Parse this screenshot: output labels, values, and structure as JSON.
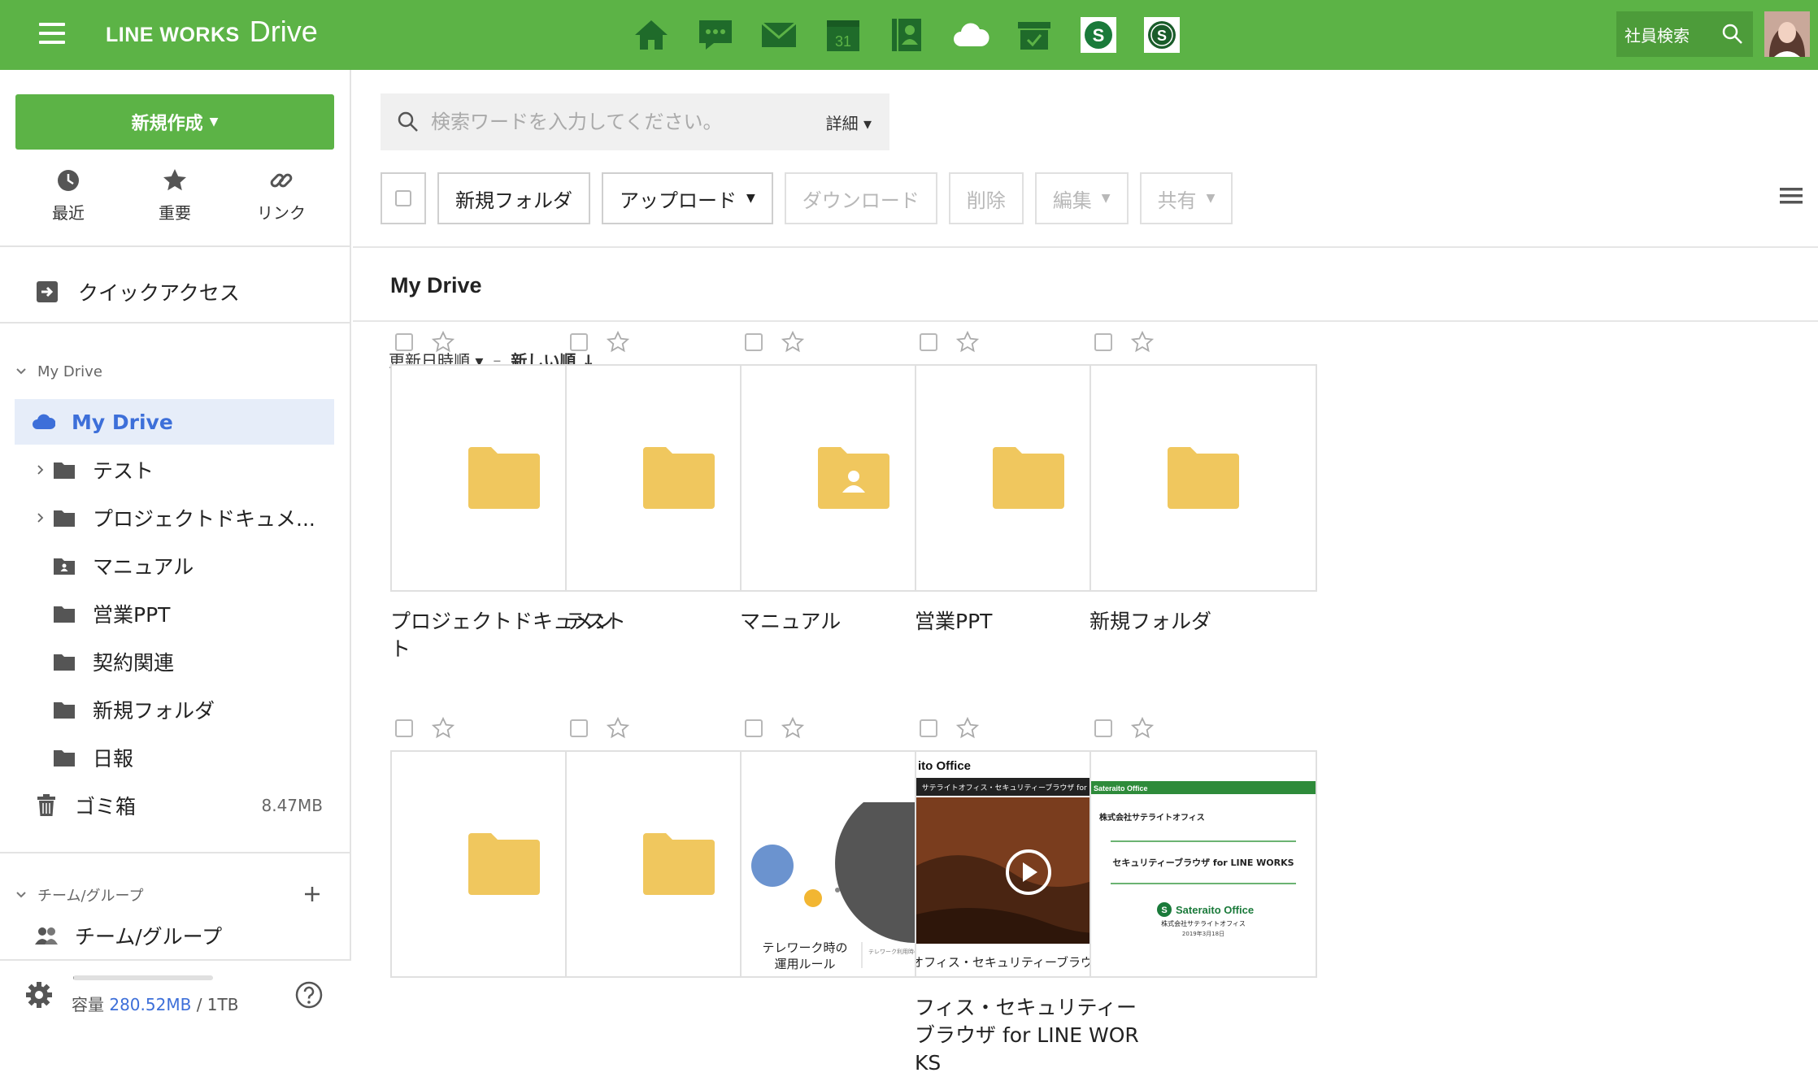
{
  "header": {
    "brand_main": "LINE WORKS",
    "brand_sub": "Drive",
    "calendar_day": "31",
    "employee_search_label": "社員検索",
    "colors": {
      "bar": "#5cb346",
      "icon": "#1f6b2a"
    }
  },
  "sidebar": {
    "new_button": "新規作成",
    "quick": [
      {
        "label": "最近",
        "icon": "clock-icon"
      },
      {
        "label": "重要",
        "icon": "star-icon"
      },
      {
        "label": "リンク",
        "icon": "link-icon"
      }
    ],
    "quick_access": "クイックアクセス",
    "my_drive_section": "My Drive",
    "tree": [
      {
        "label": "My Drive",
        "icon": "cloud-icon",
        "active": true
      },
      {
        "label": "テスト",
        "icon": "folder-icon",
        "expandable": true
      },
      {
        "label": "プロジェクトドキュメ...",
        "icon": "folder-icon",
        "expandable": true
      },
      {
        "label": "マニュアル",
        "icon": "shared-folder-icon"
      },
      {
        "label": "営業PPT",
        "icon": "folder-icon"
      },
      {
        "label": "契約関連",
        "icon": "folder-icon"
      },
      {
        "label": "新規フォルダ",
        "icon": "folder-icon"
      },
      {
        "label": "日報",
        "icon": "folder-icon"
      }
    ],
    "trash": {
      "label": "ゴミ箱",
      "size": "8.47MB"
    },
    "team_section": "チーム/グループ",
    "team_item": "チーム/グループ",
    "storage": {
      "label": "容量",
      "used": "280.52MB",
      "total": "/ 1TB",
      "used_fraction": 0.0003
    }
  },
  "main": {
    "search_placeholder": "検索ワードを入力してください。",
    "search_detail": "詳細",
    "toolbar": {
      "new_folder": "新規フォルダ",
      "upload": "アップロード",
      "download": "ダウンロード",
      "delete": "削除",
      "edit": "編集",
      "share": "共有"
    },
    "title": "My Drive",
    "sort": {
      "field": "更新日時順",
      "order": "新しい順 ↓"
    },
    "items": [
      {
        "name": "プロジェクトドキュメント",
        "type": "folder"
      },
      {
        "name": "テスト",
        "type": "folder"
      },
      {
        "name": "マニュアル",
        "type": "shared-folder"
      },
      {
        "name": "営業PPT",
        "type": "folder"
      },
      {
        "name": "新規フォルダ",
        "type": "folder"
      },
      {
        "name": "",
        "type": "folder"
      },
      {
        "name": "",
        "type": "folder"
      },
      {
        "name": "",
        "type": "doc-telework",
        "thumb_text": [
          "テレワーク時の",
          "運用ルール"
        ],
        "thumb_note": "テレワーク利用時のマニュアルです。"
      },
      {
        "name": "フィス・セキュリティーブラウザ for LINE WORKS",
        "type": "doc-slide",
        "thumb_head": "ito Office",
        "thumb_sub": "サテライトオフィス・セキュリティーブラウザ for LINE WORKS",
        "thumb_headline": "サテライトオフィス・セキュリティーブラウザ for LINE WORKS"
      },
      {
        "name": "",
        "type": "doc-pdf",
        "thumb_brand": "Sateraito Office",
        "thumb_company": "株式会社サテライトオフィス",
        "thumb_title": "セキュリティーブラウザ for LINE WORKS",
        "thumb_logo": "Sateraito Office",
        "thumb_footer": "株式会社サテライトオフィス",
        "thumb_date": "2019年3月18日"
      }
    ],
    "colors": {
      "folder": "#f0c75e",
      "accent": "#3d6fd9"
    }
  }
}
